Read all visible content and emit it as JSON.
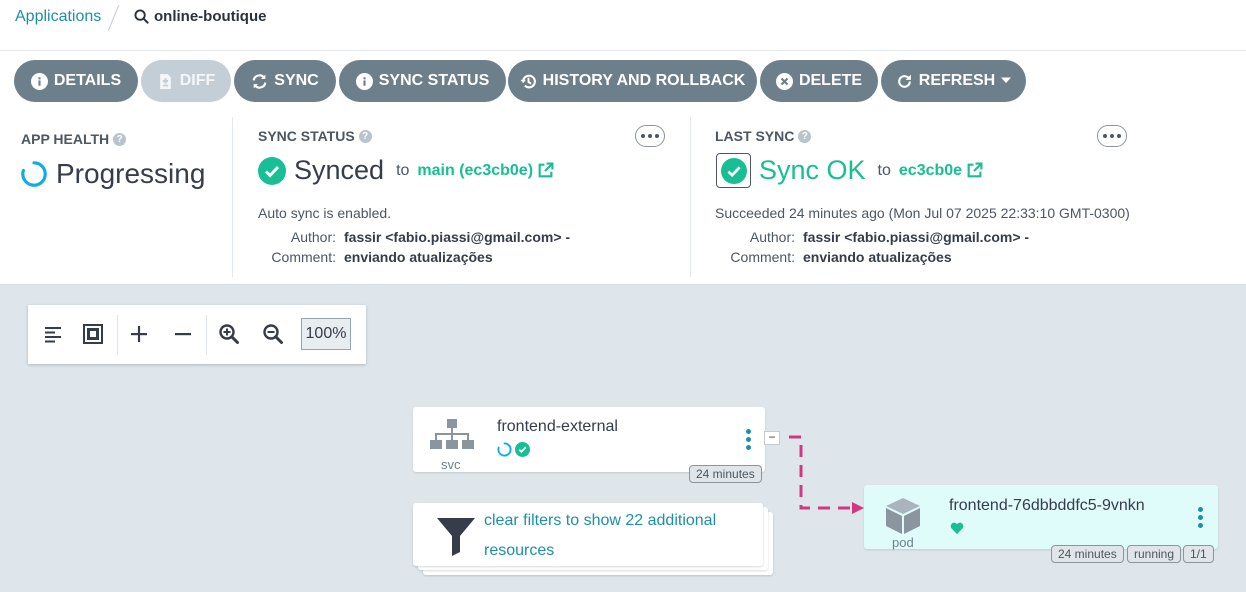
{
  "breadcrumb": {
    "applications": "Applications",
    "current": "online-boutique"
  },
  "toolbar": {
    "details": "DETAILS",
    "diff": "DIFF",
    "sync": "SYNC",
    "sync_status": "SYNC STATUS",
    "history": "HISTORY AND ROLLBACK",
    "delete": "DELETE",
    "refresh": "REFRESH"
  },
  "app_health": {
    "title": "APP HEALTH",
    "status": "Progressing"
  },
  "sync_status": {
    "title": "SYNC STATUS",
    "status": "Synced",
    "to_word": "to",
    "revision": "main (ec3cb0e)",
    "auto_sync": "Auto sync is enabled.",
    "author_label": "Author:",
    "author": "fassir <fabio.piassi@gmail.com> -",
    "comment_label": "Comment:",
    "comment": "enviando atualizações"
  },
  "last_sync": {
    "title": "LAST SYNC",
    "status": "Sync OK",
    "to_word": "to",
    "revision": "ec3cb0e",
    "succeeded": "Succeeded 24 minutes ago (Mon Jul 07 2025 22:33:10 GMT-0300)",
    "author_label": "Author:",
    "author": "fassir <fabio.piassi@gmail.com> -",
    "comment_label": "Comment:",
    "comment": "enviando atualizações"
  },
  "graph_toolbar": {
    "zoom": "100%"
  },
  "nodes": {
    "svc": {
      "name": "frontend-external",
      "kind": "svc",
      "age": "24 minutes",
      "collapse": "−"
    },
    "filter": {
      "text": "clear filters to show 22 additional resources"
    },
    "pod": {
      "name": "frontend-76dbbddfc5-9vnkn",
      "kind": "pod",
      "age": "24 minutes",
      "phase": "running",
      "ready": "1/1"
    }
  },
  "colors": {
    "accent": "#1e8fa7",
    "synced_green": "#18be94",
    "progressing_blue": "#0dadea",
    "button_gray": "#6d7f8b",
    "edge_pink": "#d1387f",
    "pod_bg": "#dffcfa"
  }
}
